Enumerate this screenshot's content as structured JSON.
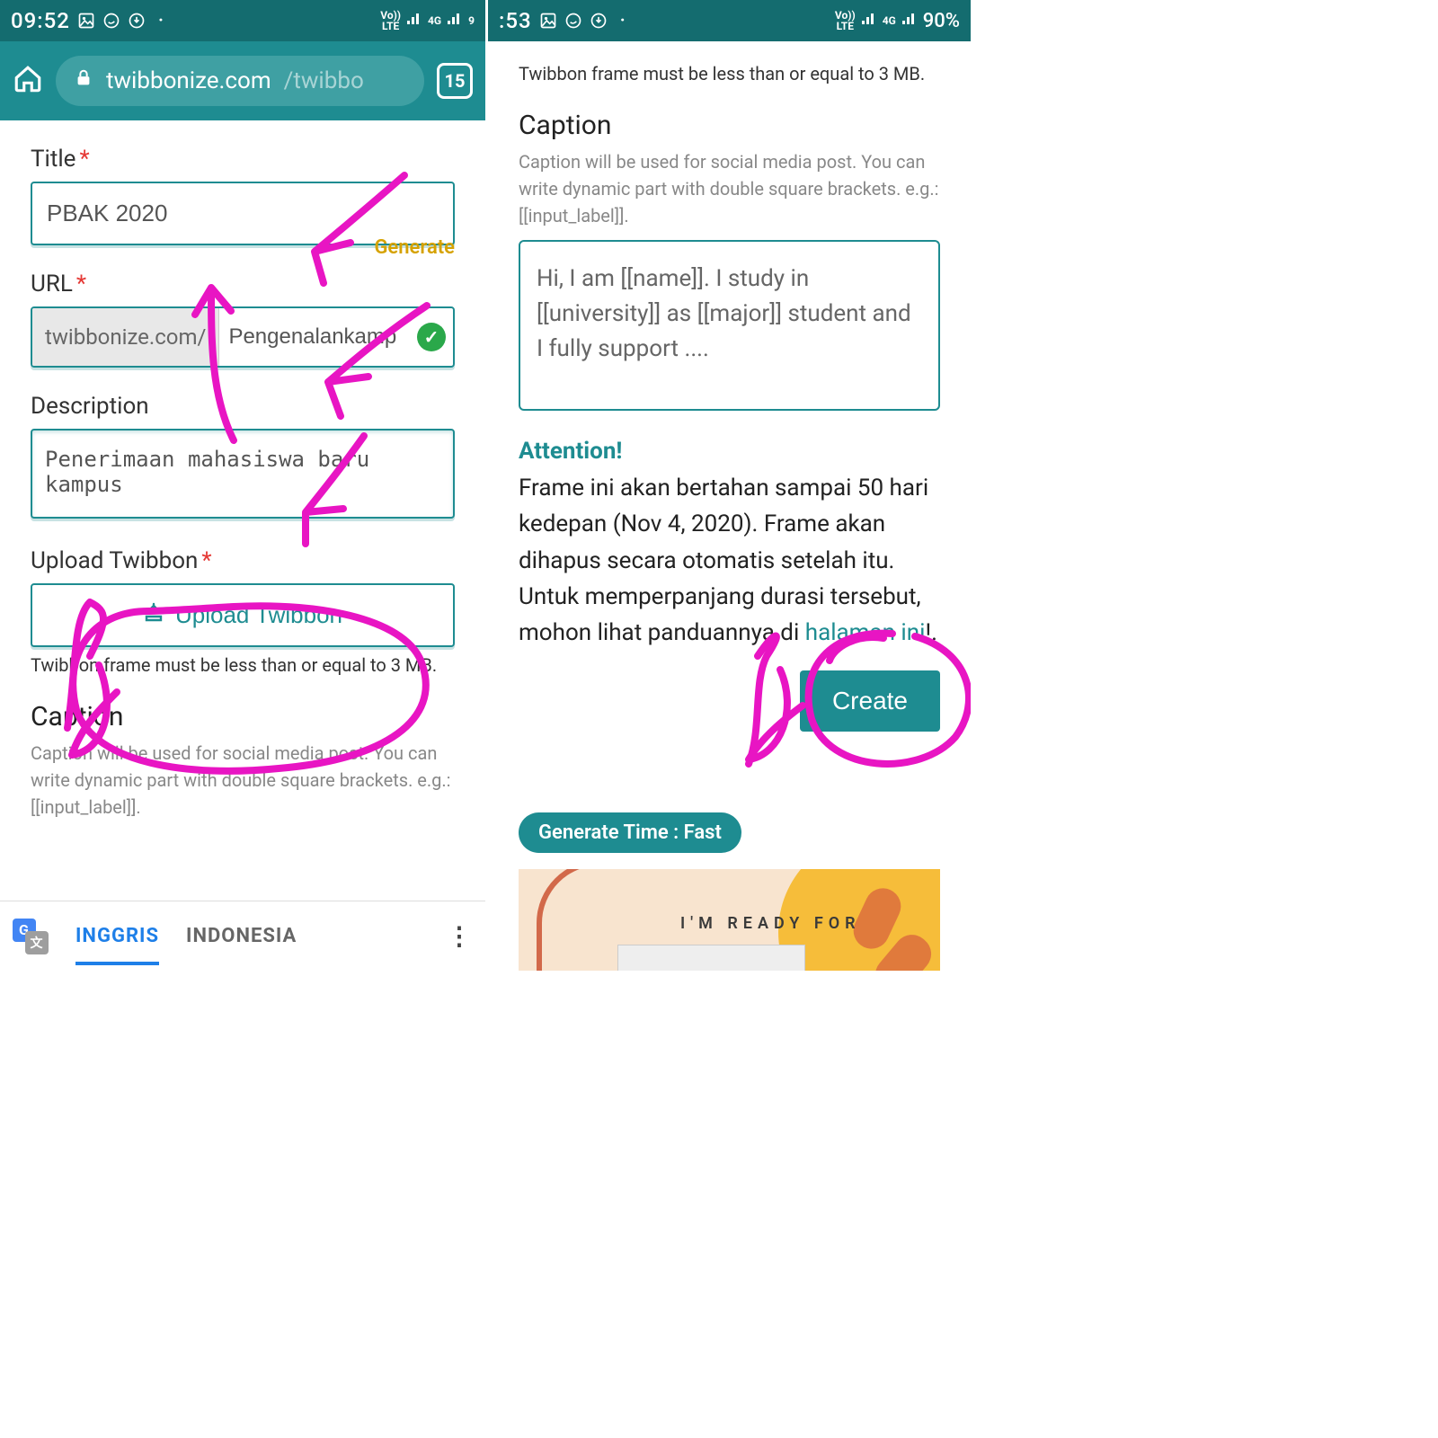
{
  "left": {
    "status": {
      "time": "09:52",
      "net1": "Vo))\nLTE",
      "net2": "4G",
      "battery": ""
    },
    "browser": {
      "domain": "twibbonize.com",
      "path": "/twibbo",
      "tab_count": "15"
    },
    "form": {
      "title_label": "Title",
      "title_value": "PBAK 2020",
      "url_label": "URL",
      "generate": "Generate",
      "url_prefix": "twibbonize.com/",
      "url_value": "Pengenalankamp",
      "desc_label": "Description",
      "desc_value": "Penerimaan mahasiswa baru kampus",
      "upload_label": "Upload Twibbon",
      "upload_btn": "Upload Twibbon",
      "upload_hint": "Twibbon frame must be less than or equal to 3 MB.",
      "caption_head": "Caption",
      "caption_hint": "Caption will be used for social media post. You can write dynamic part with double square brackets. e.g.: [[input_label]]."
    },
    "translate": {
      "active": "INGGRIS",
      "other": "INDONESIA"
    }
  },
  "right": {
    "status": {
      "time_partial": ":53",
      "net1": "Vo))\nLTE",
      "net2": "4G",
      "battery": "90%"
    },
    "upload_hint": "Twibbon frame must be less than or equal to 3 MB.",
    "caption_head": "Caption",
    "caption_hint": "Caption will be used for social media post. You can write dynamic part with double square brackets. e.g.: [[input_label]].",
    "caption_value": "Hi, I am [[name]]. I study in [[university]] as [[major]] student and I fully support ....",
    "attention_head": "Attention!",
    "attention_body_a": "Frame ini akan bertahan sampai 50 hari kedepan (Nov 4, 2020). Frame akan dihapus secara otomatis setelah itu. Untuk memperpanjang durasi tersebut, mohon lihat panduannya di ",
    "attention_link": "halaman ini",
    "attention_body_b": "!.",
    "create": "Create",
    "gen_badge": "Generate Time :  Fast",
    "banner_text": "I'M READY FOR"
  }
}
